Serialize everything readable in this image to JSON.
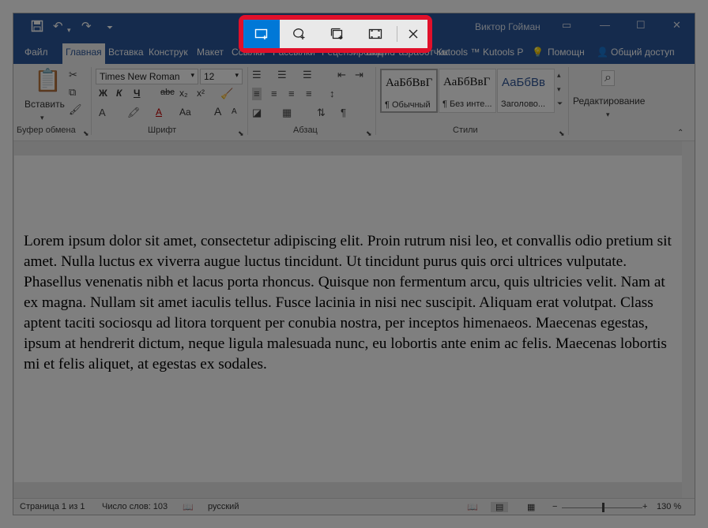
{
  "window": {
    "user_name": "Виктор Гойман",
    "quick_access": {
      "save_icon": "save-icon",
      "undo_icon": "undo-icon",
      "redo_icon": "redo-icon",
      "customize_icon": "customize-icon"
    }
  },
  "snip_toolbar": {
    "buttons": [
      {
        "name": "rectangular-snip",
        "icon": "rectangle-snip-icon",
        "active": true
      },
      {
        "name": "freeform-snip",
        "icon": "freeform-snip-icon",
        "active": false
      },
      {
        "name": "window-snip",
        "icon": "window-snip-icon",
        "active": false
      },
      {
        "name": "fullscreen-snip",
        "icon": "fullscreen-snip-icon",
        "active": false
      },
      {
        "name": "close-snip",
        "icon": "close-icon",
        "active": false
      }
    ],
    "highlight_color": "#e0102a",
    "active_color": "#0078d7"
  },
  "tabs": {
    "file": "Файл",
    "home": "Главная",
    "insert": "Вставка",
    "design": "Конструк",
    "layout": "Макет",
    "references": "Ссылки",
    "mailings": "Рассылки",
    "review": "Рецензирование",
    "view": "Вид",
    "developer": "Разработчик",
    "kutools": "Kutools ™",
    "kutools_plus": "Kutools P",
    "help": "Помощн",
    "share": "Общий доступ"
  },
  "ribbon": {
    "clipboard": {
      "paste_label": "Вставить",
      "group_label": "Буфер обмена"
    },
    "font": {
      "font_name": "Times New Roman",
      "font_size": "12",
      "bold": "Ж",
      "italic": "К",
      "underline": "Ч",
      "strike": "abc",
      "subscript": "x₂",
      "superscript": "x²",
      "grow": "A",
      "shrink": "A",
      "change_case": "Aa",
      "font_color": "A",
      "group_label": "Шрифт"
    },
    "paragraph": {
      "group_label": "Абзац"
    },
    "styles": {
      "items": [
        {
          "sample": "АаБбВвГ",
          "name": "¶ Обычный"
        },
        {
          "sample": "АаБбВвГ",
          "name": "¶ Без инте..."
        },
        {
          "sample": "АаБбВв",
          "name": "Заголово..."
        }
      ],
      "group_label": "Стили"
    },
    "editing": {
      "label": "Редактирование"
    }
  },
  "document": {
    "text": "Lorem ipsum dolor sit amet, consectetur adipiscing elit. Proin rutrum nisi leo, et convallis odio pretium sit amet. Nulla luctus ex viverra augue luctus tincidunt. Ut tincidunt purus quis orci ultrices vulputate. Phasellus venenatis nibh et lacus porta rhoncus. Quisque non fermentum arcu, quis ultricies velit. Nam at ex magna. Nullam sit amet iaculis tellus. Fusce lacinia in nisi nec suscipit. Aliquam erat volutpat. Class aptent taciti sociosqu ad litora torquent per conubia nostra, per inceptos himenaeos. Maecenas egestas, ipsum at hendrerit dictum, neque ligula malesuada nunc, eu lobortis ante enim ac felis. Maecenas lobortis mi et felis aliquet, at egestas ex sodales."
  },
  "status": {
    "page": "Страница 1 из 1",
    "words": "Число слов: 103",
    "language": "русский",
    "zoom": "130 %",
    "zoom_minus": "−",
    "zoom_plus": "+"
  },
  "colors": {
    "titlebar": "#2b579a",
    "ribbon": "#f3f3f3"
  }
}
